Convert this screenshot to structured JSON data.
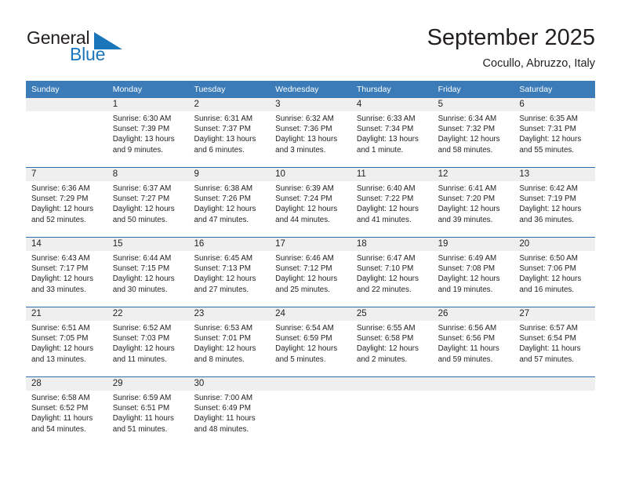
{
  "brand": {
    "word1": "General",
    "word2": "Blue",
    "accent_color": "#1b75bb"
  },
  "header": {
    "title": "September 2025",
    "location": "Cocullo, Abruzzo, Italy"
  },
  "calendar": {
    "header_bg": "#3b7cb8",
    "daynum_band_bg": "#efefef",
    "weekdays": [
      "Sunday",
      "Monday",
      "Tuesday",
      "Wednesday",
      "Thursday",
      "Friday",
      "Saturday"
    ],
    "weeks": [
      [
        {
          "day": "",
          "empty": true
        },
        {
          "day": "1",
          "sunrise": "Sunrise: 6:30 AM",
          "sunset": "Sunset: 7:39 PM",
          "daylight1": "Daylight: 13 hours",
          "daylight2": "and 9 minutes."
        },
        {
          "day": "2",
          "sunrise": "Sunrise: 6:31 AM",
          "sunset": "Sunset: 7:37 PM",
          "daylight1": "Daylight: 13 hours",
          "daylight2": "and 6 minutes."
        },
        {
          "day": "3",
          "sunrise": "Sunrise: 6:32 AM",
          "sunset": "Sunset: 7:36 PM",
          "daylight1": "Daylight: 13 hours",
          "daylight2": "and 3 minutes."
        },
        {
          "day": "4",
          "sunrise": "Sunrise: 6:33 AM",
          "sunset": "Sunset: 7:34 PM",
          "daylight1": "Daylight: 13 hours",
          "daylight2": "and 1 minute."
        },
        {
          "day": "5",
          "sunrise": "Sunrise: 6:34 AM",
          "sunset": "Sunset: 7:32 PM",
          "daylight1": "Daylight: 12 hours",
          "daylight2": "and 58 minutes."
        },
        {
          "day": "6",
          "sunrise": "Sunrise: 6:35 AM",
          "sunset": "Sunset: 7:31 PM",
          "daylight1": "Daylight: 12 hours",
          "daylight2": "and 55 minutes."
        }
      ],
      [
        {
          "day": "7",
          "sunrise": "Sunrise: 6:36 AM",
          "sunset": "Sunset: 7:29 PM",
          "daylight1": "Daylight: 12 hours",
          "daylight2": "and 52 minutes."
        },
        {
          "day": "8",
          "sunrise": "Sunrise: 6:37 AM",
          "sunset": "Sunset: 7:27 PM",
          "daylight1": "Daylight: 12 hours",
          "daylight2": "and 50 minutes."
        },
        {
          "day": "9",
          "sunrise": "Sunrise: 6:38 AM",
          "sunset": "Sunset: 7:26 PM",
          "daylight1": "Daylight: 12 hours",
          "daylight2": "and 47 minutes."
        },
        {
          "day": "10",
          "sunrise": "Sunrise: 6:39 AM",
          "sunset": "Sunset: 7:24 PM",
          "daylight1": "Daylight: 12 hours",
          "daylight2": "and 44 minutes."
        },
        {
          "day": "11",
          "sunrise": "Sunrise: 6:40 AM",
          "sunset": "Sunset: 7:22 PM",
          "daylight1": "Daylight: 12 hours",
          "daylight2": "and 41 minutes."
        },
        {
          "day": "12",
          "sunrise": "Sunrise: 6:41 AM",
          "sunset": "Sunset: 7:20 PM",
          "daylight1": "Daylight: 12 hours",
          "daylight2": "and 39 minutes."
        },
        {
          "day": "13",
          "sunrise": "Sunrise: 6:42 AM",
          "sunset": "Sunset: 7:19 PM",
          "daylight1": "Daylight: 12 hours",
          "daylight2": "and 36 minutes."
        }
      ],
      [
        {
          "day": "14",
          "sunrise": "Sunrise: 6:43 AM",
          "sunset": "Sunset: 7:17 PM",
          "daylight1": "Daylight: 12 hours",
          "daylight2": "and 33 minutes."
        },
        {
          "day": "15",
          "sunrise": "Sunrise: 6:44 AM",
          "sunset": "Sunset: 7:15 PM",
          "daylight1": "Daylight: 12 hours",
          "daylight2": "and 30 minutes."
        },
        {
          "day": "16",
          "sunrise": "Sunrise: 6:45 AM",
          "sunset": "Sunset: 7:13 PM",
          "daylight1": "Daylight: 12 hours",
          "daylight2": "and 27 minutes."
        },
        {
          "day": "17",
          "sunrise": "Sunrise: 6:46 AM",
          "sunset": "Sunset: 7:12 PM",
          "daylight1": "Daylight: 12 hours",
          "daylight2": "and 25 minutes."
        },
        {
          "day": "18",
          "sunrise": "Sunrise: 6:47 AM",
          "sunset": "Sunset: 7:10 PM",
          "daylight1": "Daylight: 12 hours",
          "daylight2": "and 22 minutes."
        },
        {
          "day": "19",
          "sunrise": "Sunrise: 6:49 AM",
          "sunset": "Sunset: 7:08 PM",
          "daylight1": "Daylight: 12 hours",
          "daylight2": "and 19 minutes."
        },
        {
          "day": "20",
          "sunrise": "Sunrise: 6:50 AM",
          "sunset": "Sunset: 7:06 PM",
          "daylight1": "Daylight: 12 hours",
          "daylight2": "and 16 minutes."
        }
      ],
      [
        {
          "day": "21",
          "sunrise": "Sunrise: 6:51 AM",
          "sunset": "Sunset: 7:05 PM",
          "daylight1": "Daylight: 12 hours",
          "daylight2": "and 13 minutes."
        },
        {
          "day": "22",
          "sunrise": "Sunrise: 6:52 AM",
          "sunset": "Sunset: 7:03 PM",
          "daylight1": "Daylight: 12 hours",
          "daylight2": "and 11 minutes."
        },
        {
          "day": "23",
          "sunrise": "Sunrise: 6:53 AM",
          "sunset": "Sunset: 7:01 PM",
          "daylight1": "Daylight: 12 hours",
          "daylight2": "and 8 minutes."
        },
        {
          "day": "24",
          "sunrise": "Sunrise: 6:54 AM",
          "sunset": "Sunset: 6:59 PM",
          "daylight1": "Daylight: 12 hours",
          "daylight2": "and 5 minutes."
        },
        {
          "day": "25",
          "sunrise": "Sunrise: 6:55 AM",
          "sunset": "Sunset: 6:58 PM",
          "daylight1": "Daylight: 12 hours",
          "daylight2": "and 2 minutes."
        },
        {
          "day": "26",
          "sunrise": "Sunrise: 6:56 AM",
          "sunset": "Sunset: 6:56 PM",
          "daylight1": "Daylight: 11 hours",
          "daylight2": "and 59 minutes."
        },
        {
          "day": "27",
          "sunrise": "Sunrise: 6:57 AM",
          "sunset": "Sunset: 6:54 PM",
          "daylight1": "Daylight: 11 hours",
          "daylight2": "and 57 minutes."
        }
      ],
      [
        {
          "day": "28",
          "sunrise": "Sunrise: 6:58 AM",
          "sunset": "Sunset: 6:52 PM",
          "daylight1": "Daylight: 11 hours",
          "daylight2": "and 54 minutes."
        },
        {
          "day": "29",
          "sunrise": "Sunrise: 6:59 AM",
          "sunset": "Sunset: 6:51 PM",
          "daylight1": "Daylight: 11 hours",
          "daylight2": "and 51 minutes."
        },
        {
          "day": "30",
          "sunrise": "Sunrise: 7:00 AM",
          "sunset": "Sunset: 6:49 PM",
          "daylight1": "Daylight: 11 hours",
          "daylight2": "and 48 minutes."
        },
        {
          "day": "",
          "empty": true
        },
        {
          "day": "",
          "empty": true
        },
        {
          "day": "",
          "empty": true
        },
        {
          "day": "",
          "empty": true
        }
      ]
    ]
  }
}
